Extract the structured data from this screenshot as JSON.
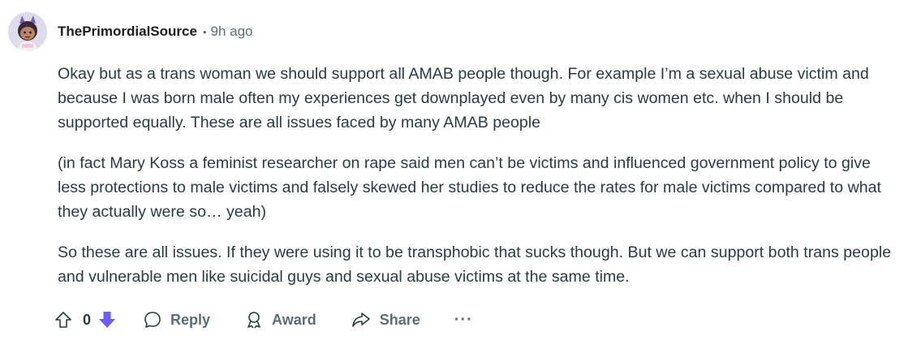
{
  "comment": {
    "author": "ThePrimordialSource",
    "separator": "•",
    "time": "9h ago",
    "paragraphs": [
      "Okay but as a trans woman we should support all AMAB people though. For example I’m a sexual abuse victim and because I was born male often my experiences get downplayed even by many cis women etc. when I should be supported equally. These are all issues faced by many AMAB people",
      "(in fact Mary Koss a feminist researcher on rape said men can’t be victims and influenced government policy to give less protections to male victims and falsely skewed her studies to reduce the rates for male victims compared to what they actually were so… yeah)",
      "So these are all issues. If they were using it to be transphobic that sucks though. But we can support both trans people and vulnerable men like suicidal guys and sexual abuse victims at the same time."
    ]
  },
  "actions": {
    "vote_count": "0",
    "reply_label": "Reply",
    "award_label": "Award",
    "share_label": "Share",
    "more_label": "···"
  },
  "colors": {
    "downvote_active": "#6a5cff",
    "meta_text": "#576f76",
    "body_text": "#2a3c42"
  },
  "icons": [
    "avatar",
    "upvote-icon",
    "downvote-icon",
    "reply-icon",
    "award-icon",
    "share-icon",
    "more-icon"
  ]
}
